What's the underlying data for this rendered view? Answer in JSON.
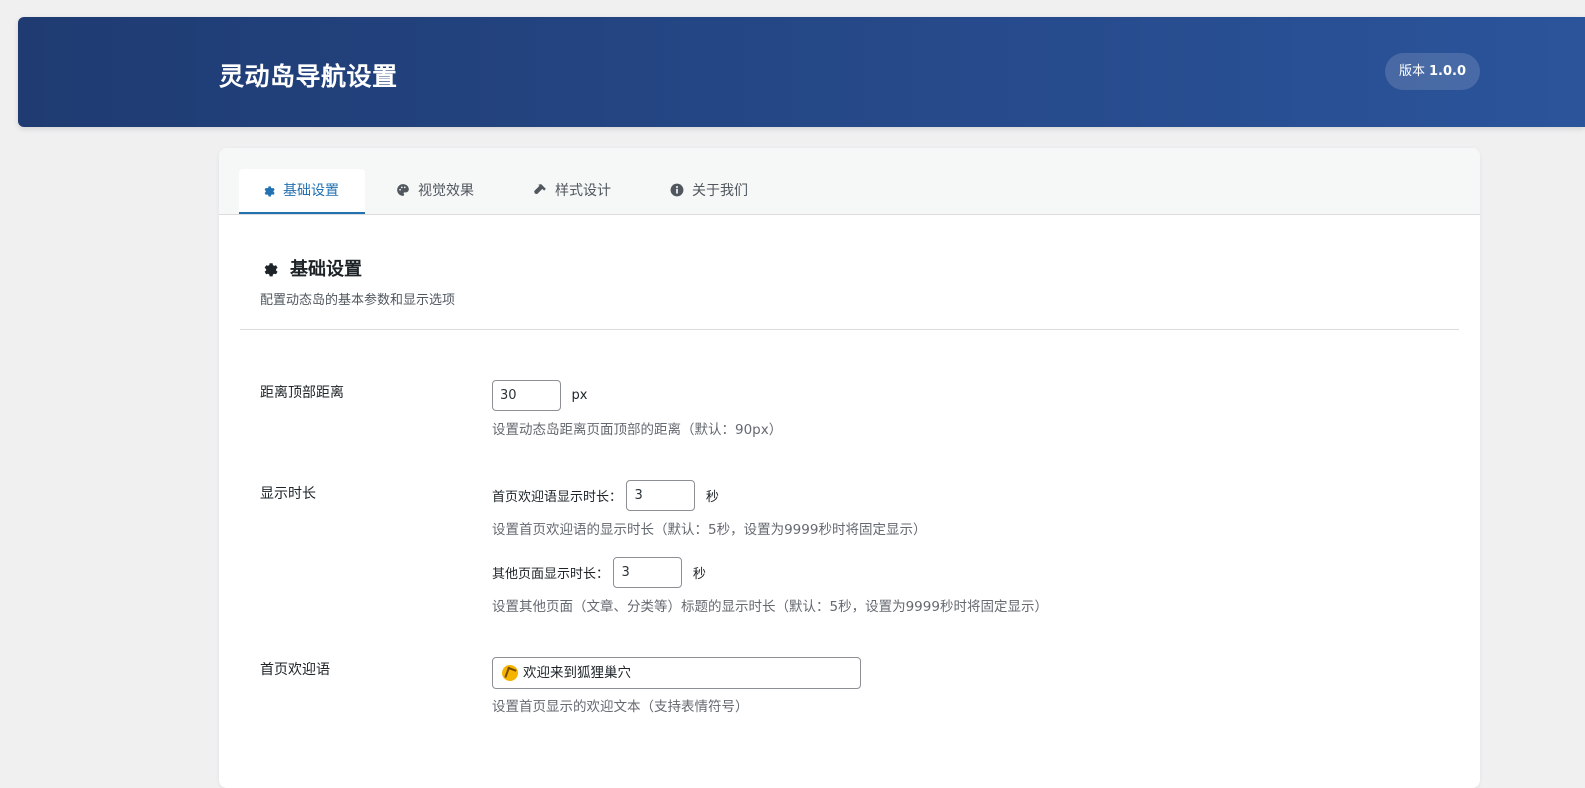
{
  "header": {
    "title": "灵动岛导航设置",
    "version_label": "版本",
    "version_number": "1.0.0"
  },
  "tabs": [
    {
      "label": "基础设置",
      "icon": "gear-icon",
      "active": true
    },
    {
      "label": "视觉效果",
      "icon": "palette-icon",
      "active": false
    },
    {
      "label": "样式设计",
      "icon": "hammer-icon",
      "active": false
    },
    {
      "label": "关于我们",
      "icon": "info-icon",
      "active": false
    }
  ],
  "section": {
    "title": "基础设置",
    "icon": "gear-icon",
    "description": "配置动态岛的基本参数和显示选项"
  },
  "fields": {
    "top_distance": {
      "label": "距离顶部距离",
      "value": "30",
      "unit": "px",
      "help": "设置动态岛距离页面顶部的距离（默认：90px）"
    },
    "display_duration": {
      "label": "显示时长",
      "home": {
        "label": "首页欢迎语显示时长：",
        "value": "3",
        "unit": "秒",
        "help": "设置首页欢迎语的显示时长（默认：5秒，设置为9999秒时将固定显示）"
      },
      "other": {
        "label": "其他页面显示时长：",
        "value": "3",
        "unit": "秒",
        "help": "设置其他页面（文章、分类等）标题的显示时长（默认：5秒，设置为9999秒时将固定显示）"
      }
    },
    "welcome": {
      "label": "首页欢迎语",
      "value": "欢迎来到狐狸巢穴",
      "emoji_icon": "waving-hand-icon",
      "help": "设置首页显示的欢迎文本（支持表情符号）"
    }
  },
  "colors": {
    "header_start": "#1f3b72",
    "header_end": "#2b549b",
    "accent": "#2271b1"
  }
}
